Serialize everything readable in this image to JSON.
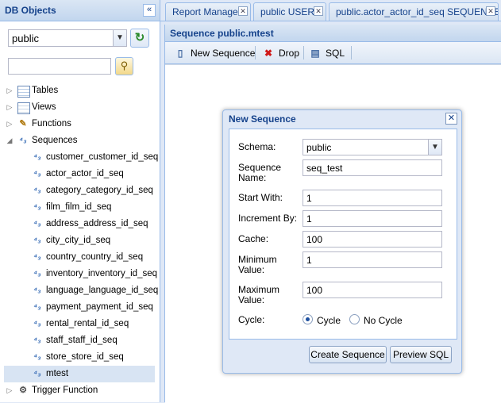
{
  "left_panel": {
    "title": "DB Objects",
    "collapse_glyph": "«",
    "schema_value": "public",
    "tree": [
      {
        "label": "Tables",
        "icon": "table-icon",
        "level": 0
      },
      {
        "label": "Views",
        "icon": "view-icon",
        "level": 0
      },
      {
        "label": "Functions",
        "icon": "function-icon",
        "level": 0
      },
      {
        "label": "Sequences",
        "icon": "sequence-icon",
        "level": 0
      },
      {
        "label": "customer_customer_id_seq",
        "icon": "sequence-icon",
        "level": 1
      },
      {
        "label": "actor_actor_id_seq",
        "icon": "sequence-icon",
        "level": 1
      },
      {
        "label": "category_category_id_seq",
        "icon": "sequence-icon",
        "level": 1
      },
      {
        "label": "film_film_id_seq",
        "icon": "sequence-icon",
        "level": 1
      },
      {
        "label": "address_address_id_seq",
        "icon": "sequence-icon",
        "level": 1
      },
      {
        "label": "city_city_id_seq",
        "icon": "sequence-icon",
        "level": 1
      },
      {
        "label": "country_country_id_seq",
        "icon": "sequence-icon",
        "level": 1
      },
      {
        "label": "inventory_inventory_id_seq",
        "icon": "sequence-icon",
        "level": 1
      },
      {
        "label": "language_language_id_seq",
        "icon": "sequence-icon",
        "level": 1
      },
      {
        "label": "payment_payment_id_seq",
        "icon": "sequence-icon",
        "level": 1
      },
      {
        "label": "rental_rental_id_seq",
        "icon": "sequence-icon",
        "level": 1
      },
      {
        "label": "staff_staff_id_seq",
        "icon": "sequence-icon",
        "level": 1
      },
      {
        "label": "store_store_id_seq",
        "icon": "sequence-icon",
        "level": 1
      },
      {
        "label": "mtest",
        "icon": "sequence-icon",
        "level": 1
      },
      {
        "label": "Trigger Function",
        "icon": "trigger-function-icon",
        "level": 0
      }
    ]
  },
  "tabs": [
    {
      "label": "Report Manager"
    },
    {
      "label": "public USERS"
    },
    {
      "label": "public.actor_actor_id_seq SEQUENCE"
    }
  ],
  "content": {
    "title": "Sequence public.mtest",
    "toolbar": {
      "new_sequence": "New Sequence",
      "drop": "Drop",
      "sql": "SQL"
    }
  },
  "dialog": {
    "title": "New Sequence",
    "fields": {
      "schema_label": "Schema:",
      "schema_value": "public",
      "name_label_1": "Sequence",
      "name_label_2": "Name:",
      "name_value": "seq_test",
      "start_label": "Start With:",
      "start_value": "1",
      "increment_label": "Increment By:",
      "increment_value": "1",
      "cache_label": "Cache:",
      "cache_value": "100",
      "min_label_1": "Minimum",
      "min_label_2": "Value:",
      "min_value": "1",
      "max_label_1": "Maximum",
      "max_label_2": "Value:",
      "max_value": "100",
      "cycle_label": "Cycle:",
      "cycle_option": "Cycle",
      "no_cycle_option": "No Cycle"
    },
    "buttons": {
      "create": "Create Sequence",
      "preview": "Preview SQL"
    }
  }
}
